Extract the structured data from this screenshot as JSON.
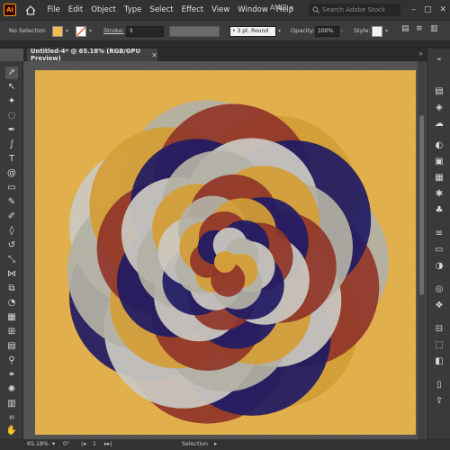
{
  "app": {
    "logo": "Ai"
  },
  "menu": [
    "File",
    "Edit",
    "Object",
    "Type",
    "Select",
    "Effect",
    "View",
    "Window",
    "Help"
  ],
  "user": {
    "name": "AMIR"
  },
  "search": {
    "placeholder": "Search Adobe Stock"
  },
  "window_controls": [
    "–",
    "□",
    "✕"
  ],
  "control_bar": {
    "selection": "No Selection",
    "stroke_label": "Stroke:",
    "brush": "3 pt. Round",
    "opacity_label": "Opacity:",
    "opacity": "100%",
    "style_label": "Style:",
    "fill_color": "#f1bc51"
  },
  "document": {
    "tab": "Untitled-4* @ 65.18% (RGB/GPU Preview)"
  },
  "status": {
    "zoom": "65.18%",
    "rotation": "0°",
    "artboard": "1",
    "tool": "Selection"
  },
  "artwork": {
    "background": "#f1bc51",
    "petal_colors": [
      "#9b3a2d",
      "#241e6a",
      "#d9d7cf",
      "#bfbdb0",
      "#e3a93a"
    ]
  }
}
